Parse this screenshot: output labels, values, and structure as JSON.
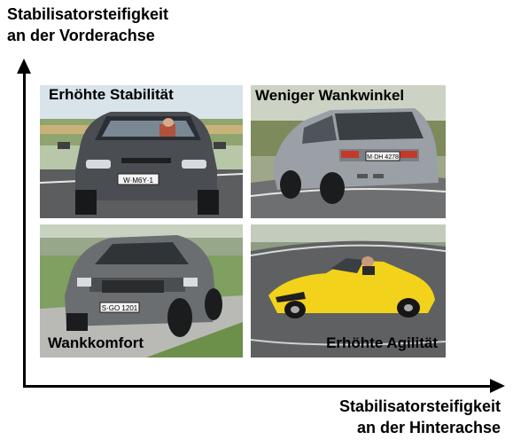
{
  "axes": {
    "y_title_line1": "Stabilisatorsteifigkeit",
    "y_title_line2": "an der Vorderachse",
    "x_title_line1": "Stabilisatorsteifigkeit",
    "x_title_line2": "an der Hinterachse"
  },
  "quadrants": {
    "top_left": {
      "label": "Erhöhte Stabilität",
      "plate": "W·M6Y·1"
    },
    "top_right": {
      "label": "Weniger Wankwinkel",
      "plate": "M·DH 4278"
    },
    "bottom_left": {
      "label": "Wankkomfort",
      "plate": "S·GO 1201"
    },
    "bottom_right": {
      "label": "Erhöhte Agilität",
      "plate": ""
    }
  },
  "colors": {
    "axis": "#000000",
    "hatchback": "#4a4d52",
    "wagon": "#9aa0a6",
    "suv": "#6b6e70",
    "roadster": "#f2d21a"
  }
}
